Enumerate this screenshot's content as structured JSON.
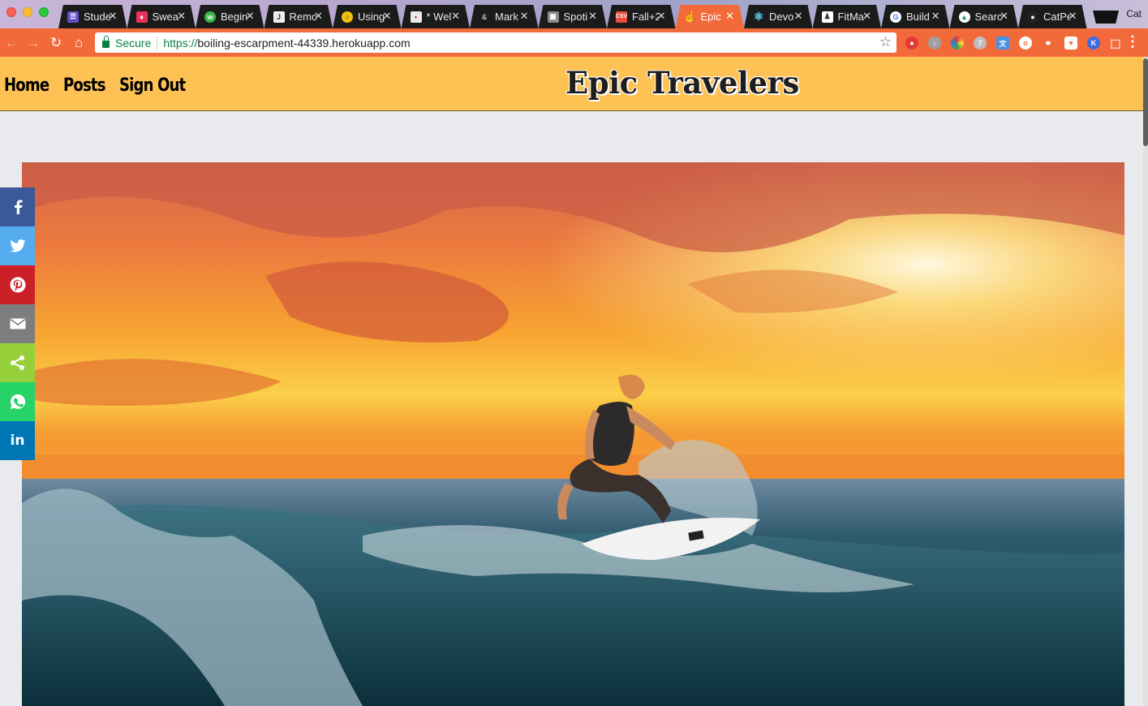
{
  "browser": {
    "tabs": [
      {
        "label": "Stude",
        "icon": "list-icon",
        "color": "#5e4ec7",
        "active": false
      },
      {
        "label": "Swea",
        "icon": "drop-icon",
        "color": "#e8315b",
        "active": false
      },
      {
        "label": "Begin",
        "icon": "wc-icon",
        "color": "#3bb54a",
        "active": false
      },
      {
        "label": "Remo",
        "icon": "doc-icon",
        "color": "#f0f0f0",
        "active": false
      },
      {
        "label": "Using",
        "icon": "search-icon",
        "color": "#f4c20d",
        "active": false
      },
      {
        "label": "* Wel",
        "icon": "page-icon",
        "color": "#e9e9e9",
        "active": false
      },
      {
        "label": "Mark",
        "icon": "markdown-icon",
        "color": "#333333",
        "active": false
      },
      {
        "label": "Spoti",
        "icon": "box-icon",
        "color": "#8a8a8a",
        "active": false
      },
      {
        "label": "Fall+2",
        "icon": "csv-icon",
        "color": "#e74c3c",
        "active": false
      },
      {
        "label": "Epic",
        "icon": "hand-icon",
        "color": "#f26a3a",
        "active": true
      },
      {
        "label": "Devo",
        "icon": "react-icon",
        "color": "#61dafb",
        "active": false
      },
      {
        "label": "FitMa",
        "icon": "figure-icon",
        "color": "#ffffff",
        "active": false
      },
      {
        "label": "Build",
        "icon": "google-icon",
        "color": "#4285f4",
        "active": false
      },
      {
        "label": "Searc",
        "icon": "drive-icon",
        "color": "#0f9d58",
        "active": false
      },
      {
        "label": "CatPe",
        "icon": "github-icon",
        "color": "#222222",
        "active": false
      }
    ],
    "profile": "Cat",
    "address": {
      "secure_label": "Secure",
      "scheme": "https://",
      "host": "boiling-escarpment-44339.herokuapp.com"
    }
  },
  "site": {
    "brand": "Epic Travelers",
    "nav": [
      "Home",
      "Posts",
      "Sign Out"
    ]
  },
  "share": [
    {
      "name": "facebook",
      "color": "#3b5998"
    },
    {
      "name": "twitter",
      "color": "#55acee"
    },
    {
      "name": "pinterest",
      "color": "#cb2027"
    },
    {
      "name": "email",
      "color": "#7d7d7d"
    },
    {
      "name": "share",
      "color": "#95d03a"
    },
    {
      "name": "whatsapp",
      "color": "#25d366"
    },
    {
      "name": "linkedin",
      "color": "#0077b5",
      "text": "in"
    }
  ],
  "hero": {
    "alt": "Surfer riding a wave at sunset"
  }
}
